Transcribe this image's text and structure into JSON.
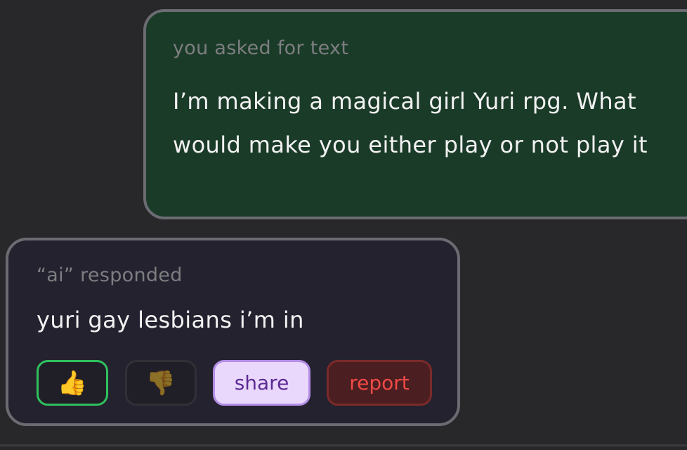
{
  "user_message": {
    "meta": "you asked for text",
    "text": "I’m making a magical girl Yuri rpg. What would make you either play or not play it"
  },
  "ai_message": {
    "meta": "“ai” responded",
    "text": "yuri gay lesbians i’m in"
  },
  "actions": {
    "thumbs_up": {
      "icon": "👍",
      "icon_name": "thumbs-up-icon",
      "border": "#2fc05e"
    },
    "thumbs_down": {
      "icon": "👎",
      "icon_name": "thumbs-down-icon",
      "border": "#303036"
    },
    "share_label": "share",
    "report_label": "report"
  },
  "colors": {
    "background": "#28272a",
    "user_bubble": "#1b3b29",
    "ai_bubble": "#24222f",
    "bubble_border": "#6b6b72",
    "meta_text": "#7c7e80",
    "message_text": "#f2f2f2",
    "share_bg": "#ead8fc",
    "share_text": "#5b2b94",
    "report_bg": "#4b1e21",
    "report_text": "#f04a46"
  }
}
